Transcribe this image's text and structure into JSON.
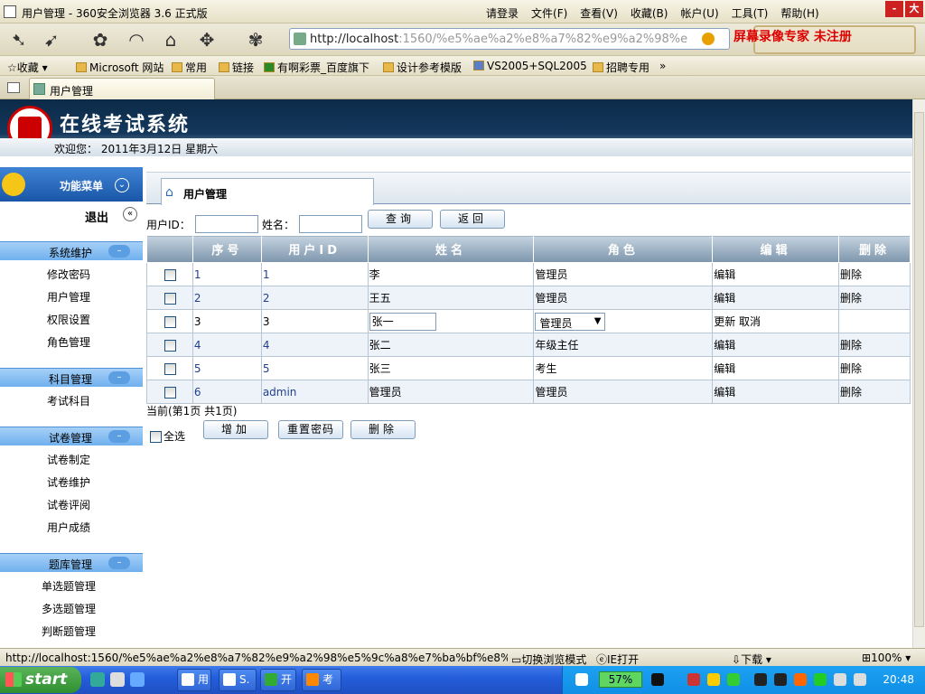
{
  "browser": {
    "window_title": "用户管理 - 360安全浏览器 3.6 正式版",
    "top_menu": [
      "请登录",
      "文件(F)",
      "查看(V)",
      "收藏(B)",
      "帐户(U)",
      "工具(T)",
      "帮助(H)"
    ],
    "window_buttons": [
      "-",
      "大"
    ],
    "address": {
      "host": "http://localhost",
      "rest": ":1560/%e5%ae%a2%e8%a7%82%e9%a2%98%e"
    },
    "watermark": "屏幕录像专家  未注册",
    "favorites": [
      "收藏",
      "Microsoft 网站",
      "常用",
      "链接",
      "有啊彩票_百度旗下",
      "设计参考模版",
      "VS2005+SQL2005",
      "招聘专用",
      "»"
    ],
    "tab_label": "用户管理"
  },
  "header": {
    "app_name": "在线考试系统",
    "welcome": "欢迎您：  2011年3月12日  星期六"
  },
  "sidebar": {
    "menu_title": "功能菜单",
    "logout": "退出",
    "groups": [
      {
        "title": "系统维护",
        "items": [
          "修改密码",
          "用户管理",
          "权限设置",
          "角色管理"
        ]
      },
      {
        "title": "科目管理",
        "items": [
          "考试科目"
        ]
      },
      {
        "title": "试卷管理",
        "items": [
          "试卷制定",
          "试卷维护",
          "试卷评阅",
          "用户成绩"
        ]
      },
      {
        "title": "题库管理",
        "items": [
          "单选题管理",
          "多选题管理",
          "判断题管理"
        ]
      }
    ]
  },
  "main": {
    "crumb": "用户管理",
    "search": {
      "userid_label": "用户ID：",
      "name_label": "姓名：",
      "userid_value": "",
      "name_value": "",
      "query_button": "查询",
      "back_button": "返回"
    },
    "table": {
      "headers": [
        "",
        "序号",
        "用户ID",
        "姓名",
        "角色",
        "编辑",
        "删除"
      ],
      "rows": [
        {
          "idx": "1",
          "uid": "1",
          "name": "李",
          "role": "管理员",
          "edit": "编辑",
          "del": "删除"
        },
        {
          "idx": "2",
          "uid": "2",
          "name": "王五",
          "role": "管理员",
          "edit": "编辑",
          "del": "删除"
        },
        {
          "idx": "3",
          "uid": "3",
          "name": "张一",
          "role": "管理员",
          "edit": "更新 取消",
          "del": "",
          "editing": true
        },
        {
          "idx": "4",
          "uid": "4",
          "name": "张二",
          "role": "年级主任",
          "edit": "编辑",
          "del": "删除"
        },
        {
          "idx": "5",
          "uid": "5",
          "name": "张三",
          "role": "考生",
          "edit": "编辑",
          "del": "删除"
        },
        {
          "idx": "6",
          "uid": "admin",
          "name": "管理员",
          "role": "管理员",
          "edit": "编辑",
          "del": "删除"
        }
      ]
    },
    "page_info": "当前(第1页 共1页)",
    "select_all": "全选",
    "actions": [
      "增加",
      "重置密码",
      "删除"
    ]
  },
  "statusbar": {
    "url": "http://localhost:1560/%e5%ae%a2%e8%a7%82%e9%a2%98%e5%9c%a8%e7%ba%bf%e8%...",
    "items": [
      "切换浏览模式",
      "IE打开",
      "下载",
      "100%"
    ]
  },
  "taskbar": {
    "start": "start",
    "buttons": [
      "用",
      "S.",
      "开",
      "考"
    ],
    "battery": "57%",
    "clock": "20:48"
  }
}
